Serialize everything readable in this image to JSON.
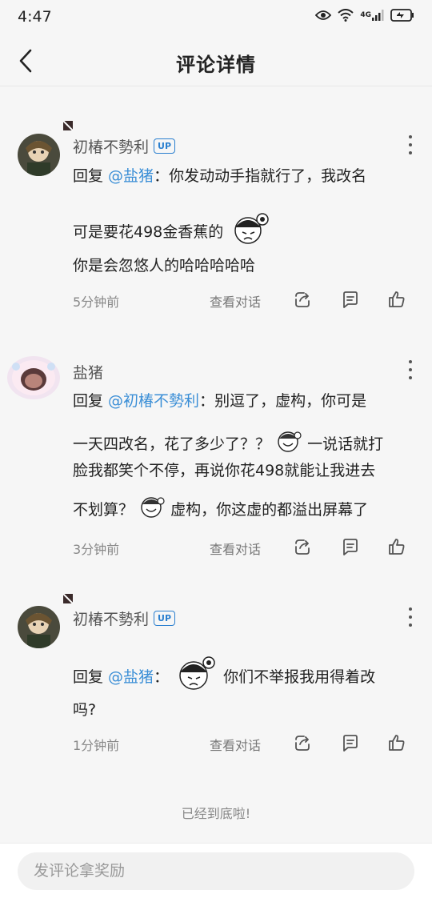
{
  "status": {
    "time": "4:47",
    "network": "4G"
  },
  "header": {
    "title": "评论详情"
  },
  "comments": [
    {
      "user": "初椿不勢利",
      "badge": "UP",
      "lines": [
        {
          "prefix": "回复 ",
          "mention": "@盐猪",
          "text": "：你发动动手指就行了，我改名"
        },
        {
          "text": "可是要花498金香蕉的"
        },
        {
          "text": "你是会忽悠人的哈哈哈哈哈"
        }
      ],
      "time": "5分钟前",
      "view_convo": "查看对话"
    },
    {
      "user": "盐猪",
      "lines": [
        {
          "prefix": "回复 ",
          "mention": "@初椿不勢利",
          "text": "：别逗了，虚构，你可是"
        },
        {
          "text": "一天四改名，花了多少了？？",
          "text2": "一说话就打"
        },
        {
          "text": "脸我都笑个不停，再说你花498就能让我进去"
        },
        {
          "text": "不划算？",
          "text2": "虚构，你这虚的都溢出屏幕了"
        }
      ],
      "time": "3分钟前",
      "view_convo": "查看对话"
    },
    {
      "user": "初椿不勢利",
      "badge": "UP",
      "lines": [
        {
          "prefix": "回复 ",
          "mention": "@盐猪",
          "text": "：",
          "text2": "你们不举报我用得着改"
        },
        {
          "text": "吗?"
        }
      ],
      "time": "1分钟前",
      "view_convo": "查看对话"
    }
  ],
  "end_text": "已经到底啦!",
  "footer": {
    "placeholder": "发评论拿奖励"
  },
  "icons": {
    "back": "chevron-left-icon",
    "more": "more-vertical-icon",
    "share": "share-icon",
    "reply": "comment-icon",
    "like": "thumbs-up-icon"
  },
  "colors": {
    "mention": "#3a8ed6",
    "badge": "#2a7fcf"
  }
}
